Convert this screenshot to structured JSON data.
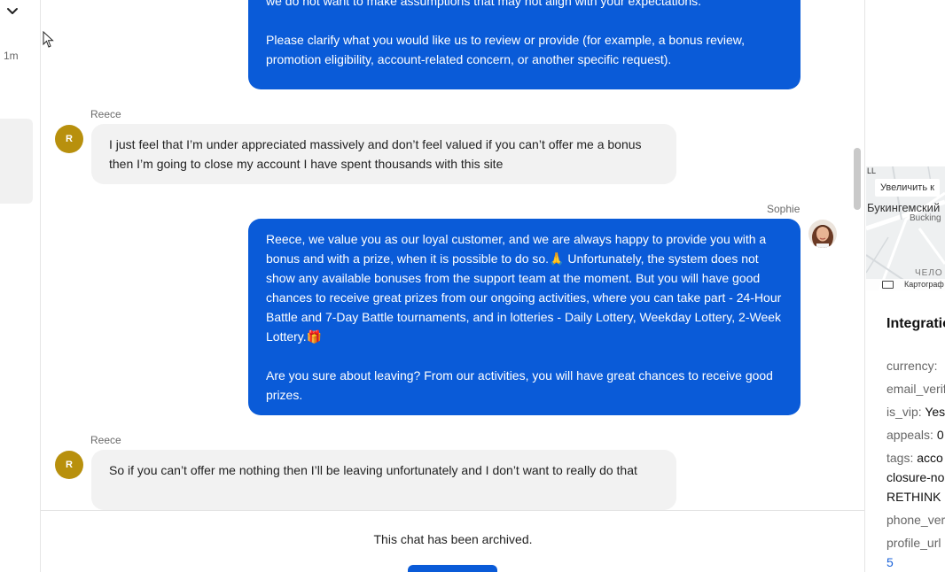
{
  "sidebar": {
    "time_ago": "1m"
  },
  "chat": {
    "messages": [
      {
        "role": "agent",
        "paragraphs": [
          "we do not want to make assumptions that may not align with your expectations.",
          "Please clarify what you would like us to review or provide (for example, a bonus review, promotion eligibility, account-related concern, or another specific request)."
        ]
      },
      {
        "role": "user",
        "sender": "Reece",
        "avatar_initial": "R",
        "text": "I just feel that I’m under appreciated massively and don’t feel valued if you can’t offer me a bonus then I’m going to close my account I have spent thousands with this site"
      },
      {
        "role": "agent",
        "sender": "Sophie",
        "paragraphs": [
          "Reece, we value you as our loyal customer, and we are always happy to provide you with a bonus and with a prize, when it is possible to do so.🙏 Unfortunately, the system does not show any available bonuses from the support team at the moment. But you will have good chances to receive great prizes from our ongoing activities, where you can take part - 24-Hour Battle and 7-Day Battle tournaments, and in lotteries - Daily Lottery, Weekday Lottery, 2-Week Lottery.🎁",
          "Are you sure about leaving? From our activities, you will have great chances to receive good prizes."
        ]
      },
      {
        "role": "user",
        "sender": "Reece",
        "avatar_initial": "R",
        "text": "So if you can’t offer me nothing then I’ll be leaving unfortunately and I don’t want to really do that"
      }
    ],
    "archived_notice": "This chat has been archived."
  },
  "map": {
    "top_label": "LL",
    "zoom_hint": "Увеличить к",
    "district": "Букингемский",
    "district_sub": "Bucking",
    "area_label": "ЧЕЛО",
    "attribution": "Картограф"
  },
  "integrations": {
    "title": "Integratio",
    "fields": [
      {
        "key": "currency:",
        "value": ""
      },
      {
        "key": "email_verif",
        "value": ""
      },
      {
        "key": "is_vip:",
        "value": "Yes"
      },
      {
        "key": "appeals:",
        "value": "0"
      },
      {
        "key": "tags:",
        "value": "acco",
        "extra_lines": [
          "closure-no",
          "RETHINK"
        ]
      },
      {
        "key": "phone_ver",
        "value": ""
      },
      {
        "key": "profile_url",
        "value": "",
        "extra_link": "5"
      }
    ]
  },
  "colors": {
    "agent_bubble": "#0a5bd8",
    "user_bubble": "#f2f2f2",
    "avatar_user": "#b8900d",
    "link": "#1a62d9"
  }
}
